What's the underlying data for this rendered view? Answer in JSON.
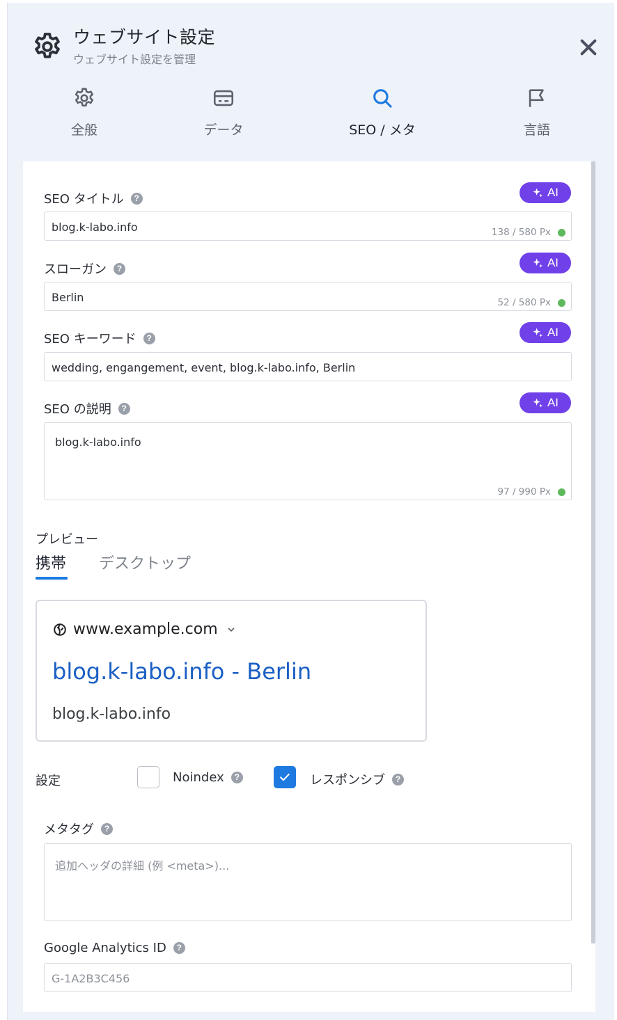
{
  "header": {
    "title": "ウェブサイト設定",
    "subtitle": "ウェブサイト設定を管理",
    "icon": "gear-icon",
    "close_icon": "close-icon"
  },
  "tabs": [
    {
      "label": "全般",
      "icon": "gear-icon",
      "active": false
    },
    {
      "label": "データ",
      "icon": "card-icon",
      "active": false
    },
    {
      "label": "SEO / メタ",
      "icon": "search-icon",
      "active": true
    },
    {
      "label": "言語",
      "icon": "flag-icon",
      "active": false
    }
  ],
  "colors": {
    "accent": "#1e7ae0",
    "ai_button": "#7040e8",
    "serp_title": "#1a5fc4",
    "status_ok": "#5eb85c"
  },
  "ai_label": "AI",
  "fields": {
    "seo_title": {
      "label": "SEO タイトル",
      "value": "blog.k-labo.info",
      "counter": "138 / 580 Px"
    },
    "slogan": {
      "label": "スローガン",
      "value": "Berlin",
      "counter": "52 / 580 Px"
    },
    "keywords": {
      "label": "SEO キーワード",
      "value": "wedding, engangement, event, blog.k-labo.info, Berlin"
    },
    "description": {
      "label": "SEO の説明",
      "value": "blog.k-labo.info",
      "counter": "97 / 990 Px"
    }
  },
  "preview": {
    "label": "プレビュー",
    "tabs": [
      {
        "label": "携帯",
        "active": true
      },
      {
        "label": "デスクトップ",
        "active": false
      }
    ],
    "url": "www.example.com",
    "title": "blog.k-labo.info - Berlin",
    "description": "blog.k-labo.info"
  },
  "settings": {
    "label": "設定",
    "noindex": {
      "label": "Noindex",
      "checked": false
    },
    "responsive": {
      "label": "レスポンシブ",
      "checked": true
    }
  },
  "meta_tags": {
    "label": "メタタグ",
    "placeholder": "追加ヘッダの詳細 (例 <meta>)..."
  },
  "analytics": {
    "label": "Google Analytics ID",
    "placeholder": "G-1A2B3C456"
  },
  "help_symbol": "?"
}
